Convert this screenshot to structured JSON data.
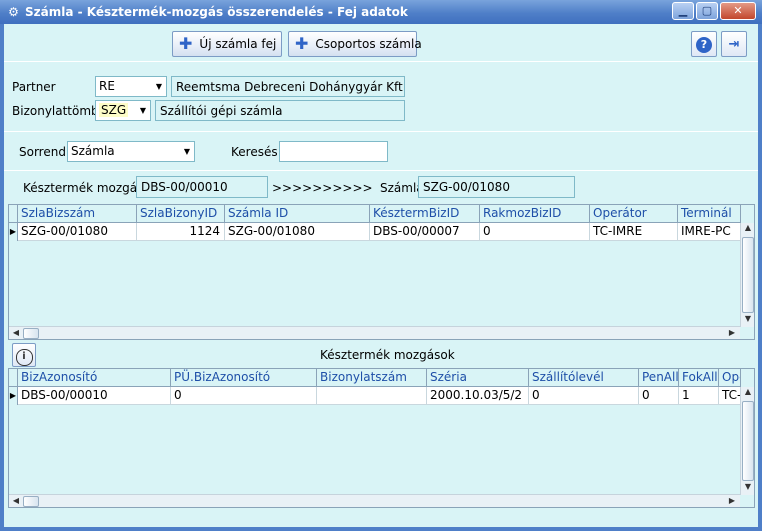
{
  "window": {
    "title": "Számla - Késztermék-mozgás összerendelés - Fej adatok",
    "controls": [
      "minimize",
      "maximize",
      "close"
    ]
  },
  "toolbar": {
    "new_invoice_label": "Új számla fej",
    "group_invoice_label": "Csoportos számla",
    "help_icon": "question-icon",
    "exit_icon": "exit-door-icon"
  },
  "header": {
    "partner_label": "Partner",
    "partner_code": "RE",
    "partner_name": "Reemtsma Debreceni Dohánygyár Kft",
    "doc_block_label": "Bizonylattömb",
    "doc_block_code": "SZG",
    "doc_block_name": "Szállítói gépi számla"
  },
  "filter": {
    "order_label": "Sorrend",
    "order_value": "Számla",
    "search_label": "Keresés",
    "search_value": ""
  },
  "link": {
    "movement_label": "Késztermék mozgás",
    "movement_value": "DBS-00/00010",
    "arrow_text": ">>>>>>>>>>",
    "invoice_label": "Számla",
    "invoice_value": "SZG-00/01080"
  },
  "invoice_grid": {
    "columns": [
      "SzlaBizszám",
      "SzlaBizonyID",
      "Számla ID",
      "KésztermBizID",
      "RakmozBizID",
      "Operátor",
      "Terminál"
    ],
    "rows": [
      [
        "SZG-00/01080",
        "1124",
        "SZG-00/01080",
        "DBS-00/00007",
        "0",
        "TC-IMRE",
        "IMRE-PC"
      ]
    ]
  },
  "movements": {
    "title": "Késztermék mozgások",
    "info_icon": "info-icon",
    "columns": [
      "BizAzonosító",
      "PÜ.BizAzonosító",
      "Bizonylatszám",
      "Széria",
      "Szállítólevél",
      "PenAll",
      "FokAll",
      "Oper"
    ],
    "rows": [
      [
        "DBS-00/00010",
        "0",
        "",
        "2000.10.03/5/2",
        "0",
        "0",
        "1",
        "TC-IM"
      ]
    ]
  },
  "colors": {
    "background": "#d9f4f6",
    "titlebar": "#4f7fc8",
    "header_text": "#1e4fa8",
    "highlight_field": "#fdfdc8"
  }
}
